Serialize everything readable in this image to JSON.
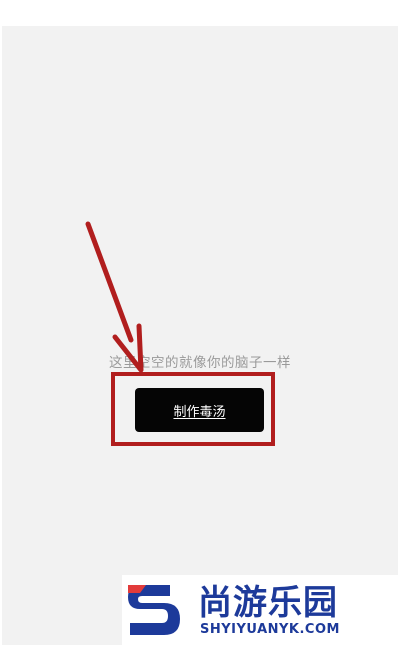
{
  "content": {
    "empty_message": "这里空空的就像你的脑子一样",
    "make_button_label": "制作毒汤"
  },
  "annotation": {
    "color": "#b11e1e"
  },
  "watermark": {
    "title": "尚游乐园",
    "subtitle": "SHYIYUANYK.COM"
  }
}
